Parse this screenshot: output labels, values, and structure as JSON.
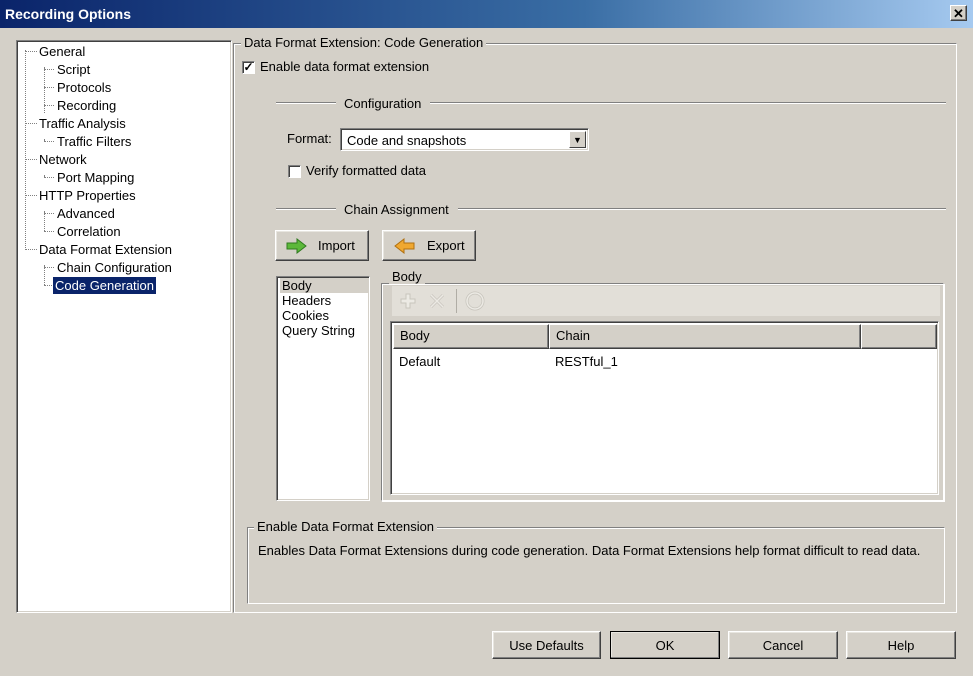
{
  "window": {
    "title": "Recording Options",
    "close_glyph": "✕"
  },
  "tree": [
    {
      "label": "General"
    },
    {
      "label": "Script"
    },
    {
      "label": "Protocols"
    },
    {
      "label": "Recording"
    },
    {
      "label": "Traffic Analysis"
    },
    {
      "label": "Traffic Filters"
    },
    {
      "label": "Network"
    },
    {
      "label": "Port Mapping"
    },
    {
      "label": "HTTP Properties"
    },
    {
      "label": "Advanced"
    },
    {
      "label": "Correlation"
    },
    {
      "label": "Data Format Extension"
    },
    {
      "label": "Chain Configuration"
    },
    {
      "label": "Code Generation",
      "selected": true
    }
  ],
  "panel": {
    "title": "Data Format Extension: Code Generation",
    "enable_checkbox": {
      "label": "Enable data format extension",
      "checked": true,
      "glyph": "✓"
    },
    "configuration_label": "Configuration",
    "format_label": "Format:",
    "format_value": "Code and snapshots",
    "verify_checkbox": {
      "label": "Verify formatted data",
      "checked": false
    },
    "chain_assignment_label": "Chain Assignment",
    "import_label": "Import",
    "export_label": "Export",
    "list": [
      "Body",
      "Headers",
      "Cookies",
      "Query String"
    ],
    "body_group_label": "Body",
    "grid": {
      "columns": [
        "Body",
        "Chain",
        ""
      ],
      "rows": [
        {
          "body": "Default",
          "chain": "RESTful_1"
        }
      ]
    },
    "description": {
      "title": "Enable Data Format Extension",
      "text": "Enables Data Format Extensions during code generation. Data Format Extensions help format difficult to read data."
    }
  },
  "buttons": {
    "use_defaults": "Use Defaults",
    "ok": "OK",
    "cancel": "Cancel",
    "help": "Help"
  },
  "colors": {
    "title_bar": "#0a246a",
    "window_bg": "#d4d0c8",
    "selection": "#0a246a",
    "import_arrow": "#5cb83a",
    "export_arrow": "#f0a830"
  }
}
